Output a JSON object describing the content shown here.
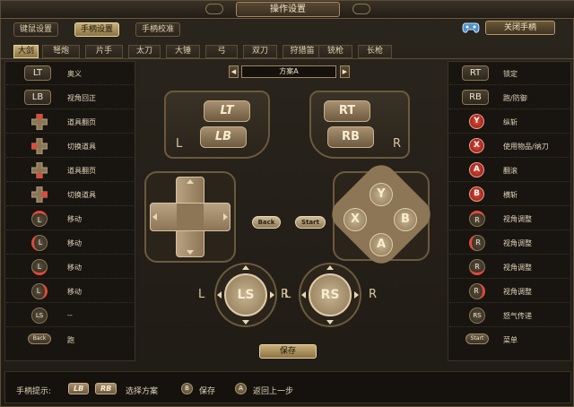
{
  "window": {
    "title": "操作设置"
  },
  "top_tabs": [
    {
      "label": "键鼠设置"
    },
    {
      "label": "手柄设置",
      "active": true
    },
    {
      "label": "手柄校准"
    }
  ],
  "close_button": "关闭手柄",
  "weapon_tabs": [
    "大剑",
    "弩炮",
    "片手",
    "太刀",
    "大锤",
    "弓",
    "双刀",
    "狩猎笛",
    "铳枪",
    "长枪"
  ],
  "scheme": {
    "name": "方案A",
    "prev": "◀",
    "next": "▶"
  },
  "left_bindings": [
    {
      "key": "LT",
      "label": "奥义"
    },
    {
      "key": "LB",
      "label": "视角回正"
    },
    {
      "key": "",
      "label": "道具翻页"
    },
    {
      "key": "",
      "label": "切换道具"
    },
    {
      "key": "",
      "label": "道具翻页"
    },
    {
      "key": "",
      "label": "切换道具"
    },
    {
      "key": "L",
      "label": "移动"
    },
    {
      "key": "L",
      "label": "移动"
    },
    {
      "key": "L",
      "label": "移动"
    },
    {
      "key": "L",
      "label": "移动"
    },
    {
      "key": "LS",
      "label": "--"
    },
    {
      "key": "Back",
      "label": "跑"
    }
  ],
  "right_bindings": [
    {
      "key": "RT",
      "label": "锁定"
    },
    {
      "key": "RB",
      "label": "跑/防御"
    },
    {
      "key": "Y",
      "label": "纵斩"
    },
    {
      "key": "X",
      "label": "使用物品/纳刀"
    },
    {
      "key": "A",
      "label": "翻滚"
    },
    {
      "key": "B",
      "label": "横斩"
    },
    {
      "key": "R",
      "label": "视角调整"
    },
    {
      "key": "R",
      "label": "视角调整"
    },
    {
      "key": "R",
      "label": "视角调整"
    },
    {
      "key": "R",
      "label": "视角调整"
    },
    {
      "key": "RS",
      "label": "怒气传递"
    },
    {
      "key": "Start",
      "label": "菜单"
    }
  ],
  "controller": {
    "lt": "LT",
    "lb": "LB",
    "rt": "RT",
    "rb": "RB",
    "left_side": "L",
    "right_side": "R",
    "back": "Back",
    "start": "Start",
    "y": "Y",
    "x": "X",
    "b": "B",
    "a": "A",
    "ls": "LS",
    "rs": "RS",
    "ls_left": "L",
    "ls_right": "R",
    "rs_left": "L",
    "rs_right": "R"
  },
  "save_button": "保存",
  "hint": {
    "prefix": "手柄提示:",
    "key_lb": "LB",
    "key_rb": "RB",
    "text1": "选择方案",
    "key_b": "B",
    "text2": "保存",
    "key_a": "A",
    "text3": "返回上一步"
  }
}
